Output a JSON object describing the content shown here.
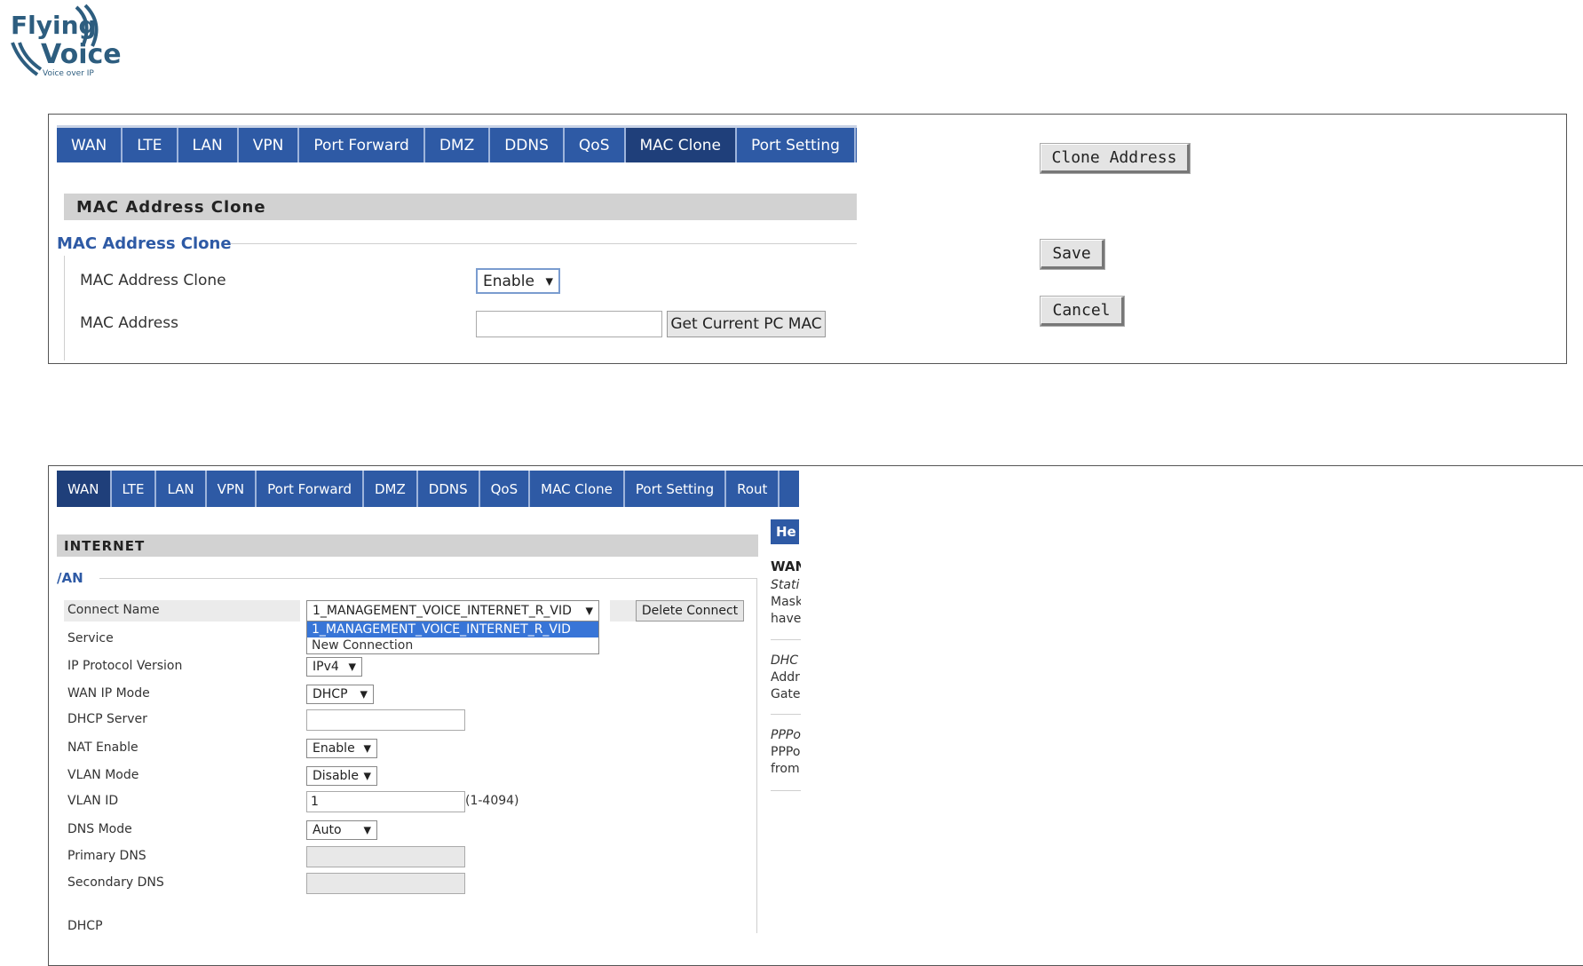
{
  "logo": {
    "line1": "Flying",
    "line2": "Voice",
    "tagline": "Voice over IP",
    "color": "#2d5d7f"
  },
  "colors": {
    "tab_bg": "#2e5aa5",
    "tab_active": "#1f3f7a",
    "section_bg": "#d2d2d2",
    "accent": "#2e5aa5",
    "dropdown_selected": "#3875d7"
  },
  "panel1": {
    "tabs": [
      "WAN",
      "LTE",
      "LAN",
      "VPN",
      "Port Forward",
      "DMZ",
      "DDNS",
      "QoS",
      "MAC Clone",
      "Port Setting"
    ],
    "active_tab": "MAC Clone",
    "section_title": "MAC Address Clone",
    "fieldset_title": "MAC Address Clone",
    "rows": {
      "mac_clone_label": "MAC Address Clone",
      "mac_clone_value": "Enable",
      "mac_address_label": "MAC Address",
      "mac_address_value": "",
      "get_mac_button": "Get Current PC MAC"
    },
    "side_buttons": {
      "clone": "Clone Address",
      "save": "Save",
      "cancel": "Cancel"
    }
  },
  "panel2": {
    "tabs": [
      "WAN",
      "LTE",
      "LAN",
      "VPN",
      "Port Forward",
      "DMZ",
      "DDNS",
      "QoS",
      "MAC Clone",
      "Port Setting",
      "Rout"
    ],
    "active_tab": "WAN",
    "section_title": "INTERNET",
    "fieldset_title": "/AN",
    "fields": {
      "connect_name_label": "Connect Name",
      "connect_name_value": "1_MANAGEMENT_VOICE_INTERNET_R_VID",
      "delete_button": "Delete Connect",
      "dropdown_options": [
        "1_MANAGEMENT_VOICE_INTERNET_R_VID",
        "New Connection"
      ],
      "service_label": "Service",
      "ip_protocol_label": "IP Protocol Version",
      "ip_protocol_value": "IPv4",
      "wan_ip_mode_label": "WAN IP Mode",
      "wan_ip_mode_value": "DHCP",
      "dhcp_server_label": "DHCP Server",
      "dhcp_server_value": "",
      "nat_label": "NAT Enable",
      "nat_value": "Enable",
      "vlan_mode_label": "VLAN Mode",
      "vlan_mode_value": "Disable",
      "vlan_id_label": "VLAN ID",
      "vlan_id_value": "1",
      "vlan_id_range": "(1-4094)",
      "dns_mode_label": "DNS Mode",
      "dns_mode_value": "Auto",
      "primary_dns_label": "Primary DNS",
      "primary_dns_value": "",
      "secondary_dns_label": "Secondary DNS",
      "secondary_dns_value": "",
      "dhcp_label": "DHCP"
    },
    "help": {
      "title": "He",
      "heading": "WAN",
      "lines": [
        "Stati",
        "Mask",
        "have",
        "DHC",
        "Addr",
        "Gate",
        "PPPo",
        "PPPo",
        "from"
      ]
    }
  }
}
